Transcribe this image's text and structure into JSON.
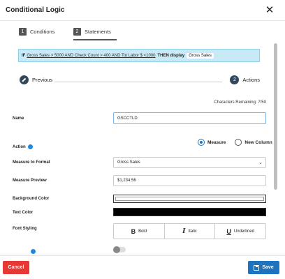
{
  "dialog": {
    "title": "Conditional Logic",
    "close_glyph": "✕"
  },
  "tabs": [
    {
      "num": "1",
      "label": "Conditions",
      "active": false
    },
    {
      "num": "2",
      "label": "Statements",
      "active": true
    }
  ],
  "logic": {
    "if": "IF",
    "condition": "Gross Sales > 5000 AND Check Count > 400 AND Tot Labor $ <1000",
    "then": "THEN display",
    "target": "Gross Sales"
  },
  "stepper": {
    "previous_label": "Previous",
    "actions_num": "2",
    "actions_label": "Actions"
  },
  "form": {
    "chars_remaining": "Characters Remaining: 7/50",
    "name_label": "Name",
    "name_value": "GSCCTLD",
    "action_label": "Action",
    "action_options": [
      "Measure",
      "New Column"
    ],
    "action_selected": "Measure",
    "measure_format_label": "Measure to Format",
    "measure_format_value": "Gross Sales",
    "measure_preview_label": "Measure Preview",
    "measure_preview_value": "$1,234.56",
    "bg_color_label": "Background Color",
    "text_color_label": "Text Color",
    "font_styling_label": "Font Styling",
    "font_styles": [
      {
        "glyph": "B",
        "label": "Bold"
      },
      {
        "glyph": "I",
        "label": "Italic"
      },
      {
        "glyph": "U",
        "label": "Underlined"
      }
    ]
  },
  "colors": {
    "background": "#ffffff",
    "text": "#000000",
    "accent": "#1e73be",
    "danger": "#e53935",
    "logic_bg": "#c8eaf6"
  },
  "footer": {
    "cancel_label": "Cancel",
    "save_label": "Save"
  }
}
